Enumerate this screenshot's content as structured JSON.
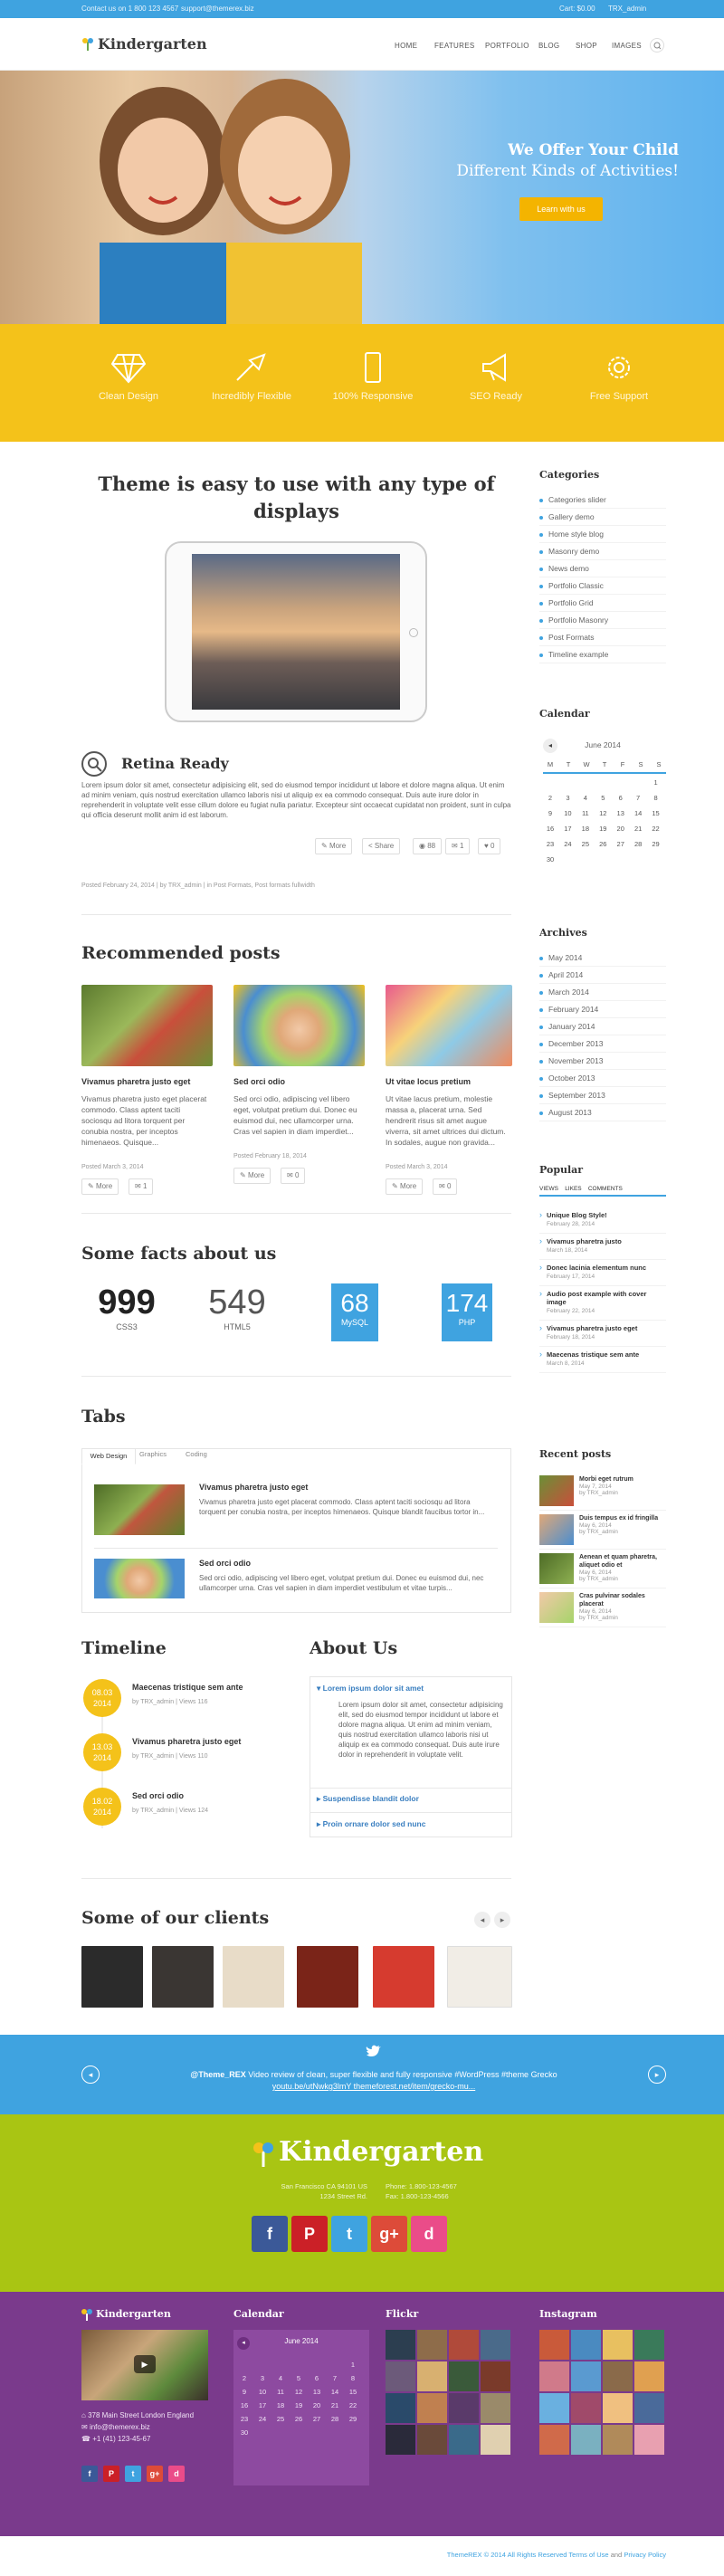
{
  "topbar": {
    "phone": "Contact us on 1 800 123 4567",
    "email": "support@themerex.biz",
    "cart": "Cart: $0.00",
    "user": "TRX_admin"
  },
  "header": {
    "logo": "Kindergarten",
    "nav": [
      "Home",
      "Features",
      "Portfolio",
      "Blog",
      "Shop",
      "Images"
    ]
  },
  "hero": {
    "title": "We Offer Your Child",
    "subtitle": "Different Kinds of Activities!",
    "button": "Learn with us"
  },
  "features": [
    "Clean Design",
    "Incredibly Flexible",
    "100% Responsive",
    "SEO Ready",
    "Free Support"
  ],
  "main": {
    "headline1": "Theme is easy to use with any type of",
    "headline2": "displays",
    "retina": {
      "title": "Retina Ready",
      "text": "Lorem ipsum dolor sit amet, consectetur adipisicing elit, sed do eiusmod tempor incididunt ut labore et dolore magna aliqua. Ut enim ad minim veniam, quis nostrud exercitation ullamco laboris nisi ut aliquip ex ea commodo consequat. Duis aute irure dolor in reprehenderit in voluptate velit esse cillum dolore eu fugiat nulla pariatur. Excepteur sint occaecat cupidatat non proident, sunt in culpa qui officia deserunt mollit anim id est laborum.",
      "more": "More",
      "share": "Share",
      "views": "88",
      "comments": "1",
      "likes": "0",
      "meta": "Posted February 24, 2014 | by TRX_admin | in Post Formats, Post formats fullwidth"
    },
    "recommended_title": "Recommended posts",
    "recommended": [
      {
        "title": "Vivamus pharetra justo eget",
        "text": "Vivamus pharetra justo eget placerat commodo. Class aptent taciti sociosqu ad litora torquent per conubia nostra, per inceptos himenaeos. Quisque...",
        "date": "Posted March 3, 2014",
        "more": "More",
        "count": "1"
      },
      {
        "title": "Sed orci odio",
        "text": "Sed orci odio, adipiscing vel libero eget, volutpat pretium dui. Donec eu euismod dui, nec ullamcorper urna. Cras vel sapien in diam imperdiet...",
        "date": "Posted February 18, 2014",
        "more": "More",
        "count": "0"
      },
      {
        "title": "Ut vitae locus pretium",
        "text": "Ut vitae lacus pretium, molestie massa a, placerat urna. Sed hendrerit risus sit amet augue viverra, sit amet ultrices dui dictum. In sodales, augue non gravida...",
        "date": "Posted March 3, 2014",
        "more": "More",
        "count": "0"
      }
    ],
    "facts_title": "Some facts about us",
    "facts": [
      {
        "value": "999",
        "label": "CSS3"
      },
      {
        "value": "549",
        "label": "HTML5"
      },
      {
        "value": "68",
        "label": "MySQL"
      },
      {
        "value": "174",
        "label": "PHP"
      }
    ],
    "tabs_title": "Tabs",
    "tabs": [
      "Web Design",
      "Graphics",
      "Coding"
    ],
    "tab_posts": [
      {
        "title": "Vivamus pharetra justo eget",
        "text": "Vivamus pharetra justo eget placerat commodo. Class aptent taciti sociosqu ad litora torquent per conubia nostra, per inceptos himenaeos. Quisque blandit faucibus tortor in..."
      },
      {
        "title": "Sed orci odio",
        "text": "Sed orci odio, adipiscing vel libero eget, volutpat pretium dui. Donec eu euismod dui, nec ullamcorper urna. Cras vel sapien in diam imperdiet vestibulum et vitae turpis..."
      }
    ],
    "timeline_title": "Timeline",
    "timeline": [
      {
        "date": "08.03",
        "year": "2014",
        "title": "Maecenas tristique sem ante",
        "meta": "by TRX_admin | Views 116"
      },
      {
        "date": "13.03",
        "year": "2014",
        "title": "Vivamus pharetra justo eget",
        "meta": "by TRX_admin | Views 110"
      },
      {
        "date": "18.02",
        "year": "2014",
        "title": "Sed orci odio",
        "meta": "by TRX_admin | Views 124"
      }
    ],
    "about_title": "About Us",
    "about": [
      {
        "title": "Lorem ipsum dolor sit amet",
        "text": "Lorem ipsum dolor sit amet, consectetur adipisicing elit, sed do eiusmod tempor incididunt ut labore et dolore magna aliqua. Ut enim ad minim veniam, quis nostrud exercitation ullamco laboris nisi ut aliquip ex ea commodo consequat. Duis aute irure dolor in reprehenderit in voluptate velit."
      },
      {
        "title": "Suspendisse blandit dolor"
      },
      {
        "title": "Proin ornare dolor sed nunc"
      }
    ],
    "clients_title": "Some of our clients"
  },
  "sidebar": {
    "categories_title": "Categories",
    "categories": [
      "Categories slider",
      "Gallery demo",
      "Home style blog",
      "Masonry demo",
      "News demo",
      "Portfolio Classic",
      "Portfolio Grid",
      "Portfolio Masonry",
      "Post Formats",
      "Timeline example"
    ],
    "calendar_title": "Calendar",
    "calendar_month": "June 2014",
    "calendar_days": [
      "M",
      "T",
      "W",
      "T",
      "F",
      "S",
      "S"
    ],
    "calendar_dates": [
      "",
      "",
      "",
      "",
      "",
      "",
      "1",
      "2",
      "3",
      "4",
      "5",
      "6",
      "7",
      "8",
      "9",
      "10",
      "11",
      "12",
      "13",
      "14",
      "15",
      "16",
      "17",
      "18",
      "19",
      "20",
      "21",
      "22",
      "23",
      "24",
      "25",
      "26",
      "27",
      "28",
      "29",
      "30"
    ],
    "archives_title": "Archives",
    "archives": [
      "May 2014",
      "April 2014",
      "March 2014",
      "February 2014",
      "January 2014",
      "December 2013",
      "November 2013",
      "October 2013",
      "September 2013",
      "August 2013"
    ],
    "popular_title": "Popular",
    "popular_tabs": [
      "Views",
      "Likes",
      "Comments"
    ],
    "popular": [
      {
        "title": "Unique Blog Style!",
        "date": "February 28, 2014"
      },
      {
        "title": "Vivamus pharetra justo",
        "date": "March 18, 2014"
      },
      {
        "title": "Donec lacinia elementum nunc",
        "date": "February 17, 2014"
      },
      {
        "title": "Audio post example with cover image",
        "date": "February 22, 2014"
      },
      {
        "title": "Vivamus pharetra justo eget",
        "date": "February 18, 2014"
      },
      {
        "title": "Maecenas tristique sem ante",
        "date": "March 8, 2014"
      }
    ],
    "recent_title": "Recent posts",
    "recent": [
      {
        "title": "Morbi eget rutrum",
        "date": "May 7, 2014",
        "by": "by TRX_admin"
      },
      {
        "title": "Duis tempus ex id fringilla",
        "date": "May 6, 2014",
        "by": "by TRX_admin"
      },
      {
        "title": "Aenean et quam pharetra, aliquet odio et",
        "date": "May 6, 2014",
        "by": "by TRX_admin"
      },
      {
        "title": "Cras pulvinar sodales placerat",
        "date": "May 6, 2014",
        "by": "by TRX_admin"
      }
    ]
  },
  "twitter": {
    "user": "@Theme_REX",
    "line1": "Video review of clean, super flexible and fully responsive #WordPress #theme Grecko",
    "line2": "youtu.be/utNwkg3lmY themeforest.net/item/grecko-mu..."
  },
  "footer": {
    "logo": "Kindergarten",
    "address1": "San Francisco CA 94101 US",
    "address2": "1234 Street Rd.",
    "phone": "Phone: 1.800-123-4567",
    "fax": "Fax: 1.800-123-4566",
    "socials": [
      "f",
      "P",
      "t",
      "g+",
      "d"
    ],
    "col_titles": [
      "Kindergarten",
      "Calendar",
      "Flickr",
      "Instagram"
    ],
    "contact": [
      "378 Main Street London England",
      "info@themerex.biz",
      "+1 (41) 123-45-67"
    ],
    "calendar_month": "June 2014",
    "copyright": "ThemeREX © 2014 All Rights Reserved",
    "terms": "Terms of Use",
    "and": "and",
    "privacy": "Privacy Policy"
  }
}
